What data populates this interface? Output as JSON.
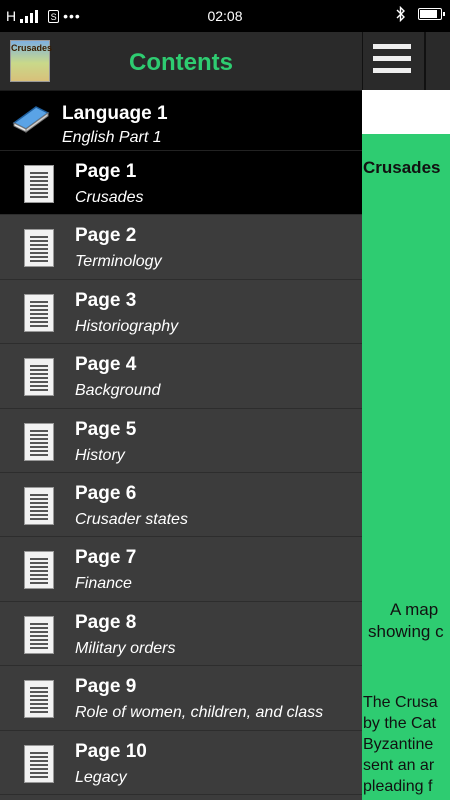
{
  "status_bar": {
    "carrier": "H",
    "sim_label": "S",
    "dots": "•••",
    "time": "02:08",
    "battery_level": 0.9
  },
  "drawer": {
    "title": "Contents",
    "app_icon_text": "Crusades",
    "language": {
      "title": "Language 1",
      "subtitle": "English Part 1"
    },
    "items": [
      {
        "title": "Page 1",
        "subtitle": "Crusades"
      },
      {
        "title": "Page 2",
        "subtitle": "Terminology"
      },
      {
        "title": "Page 3",
        "subtitle": "Historiography"
      },
      {
        "title": "Page 4",
        "subtitle": "Background"
      },
      {
        "title": "Page 5",
        "subtitle": "History"
      },
      {
        "title": "Page 6",
        "subtitle": "Crusader states"
      },
      {
        "title": "Page 7",
        "subtitle": "Finance"
      },
      {
        "title": "Page 8",
        "subtitle": "Military orders"
      },
      {
        "title": "Page 9",
        "subtitle": "Role of women, children, and class"
      },
      {
        "title": "Page 10",
        "subtitle": "Legacy"
      }
    ],
    "active_index": 0
  },
  "content": {
    "title": "Crusades",
    "caption_line1": "A map",
    "caption_line2": "showing c",
    "body_lines": [
      "The Crusa",
      "by the Cat",
      "Byzantine",
      "sent an ar",
      "pleading f"
    ]
  },
  "colors": {
    "accent": "#2ecc71",
    "drawer_bg": "#3c3c3c",
    "active_bg": "#000000"
  }
}
